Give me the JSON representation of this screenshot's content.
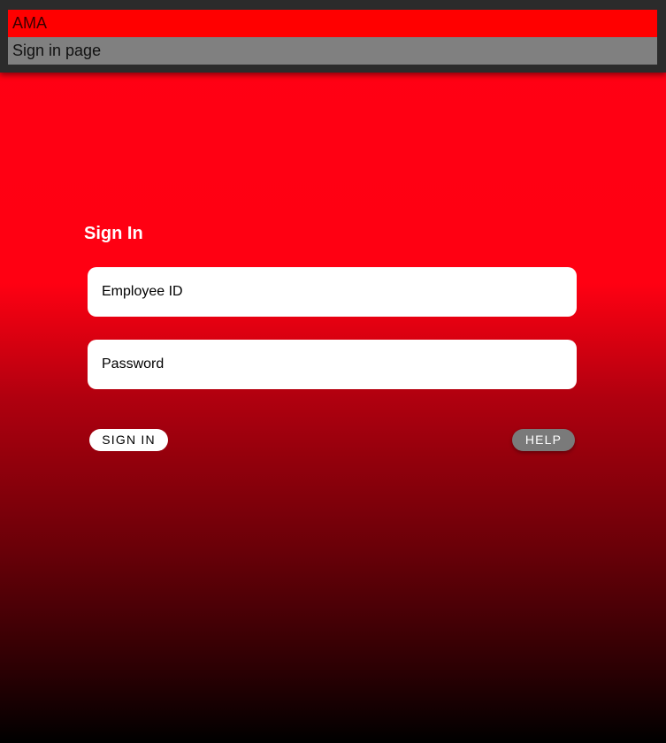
{
  "header": {
    "brand": "AMA",
    "page_subtitle": "Sign in page"
  },
  "form": {
    "title": "Sign In",
    "employee_id_placeholder": "Employee ID",
    "password_placeholder": "Password",
    "sign_in_label": "SIGN IN",
    "help_label": "HELP"
  },
  "colors": {
    "brand_bar": "#ff0000",
    "subtitle_bar": "#808080",
    "header_bg": "#2b2b2b",
    "gradient_top": "#ff0014",
    "gradient_bottom": "#000000",
    "help_button": "#7a7a7a"
  }
}
